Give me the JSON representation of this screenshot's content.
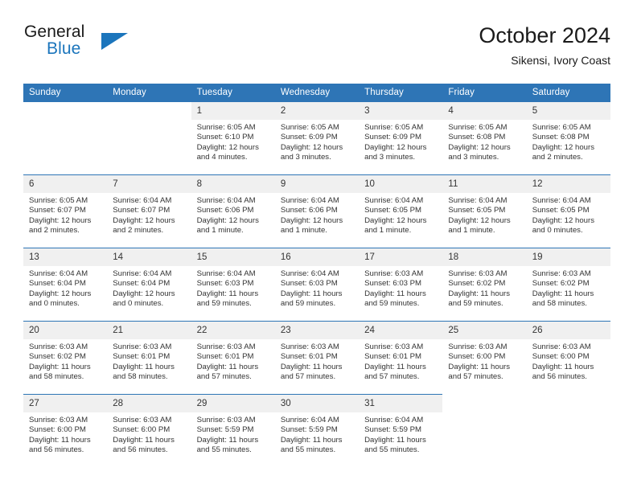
{
  "brand": {
    "name_top": "General",
    "name_bottom": "Blue",
    "triangle_color": "#1b75bc"
  },
  "header": {
    "title": "October 2024",
    "subtitle": "Sikensi, Ivory Coast"
  },
  "colors": {
    "header_blue": "#2e75b6",
    "daynum_band": "#f0f0f0",
    "text": "#333333"
  },
  "calendar": {
    "weekday_headers": [
      "Sunday",
      "Monday",
      "Tuesday",
      "Wednesday",
      "Thursday",
      "Friday",
      "Saturday"
    ],
    "weeks": [
      [
        {
          "day": "",
          "empty": true
        },
        {
          "day": "",
          "empty": true
        },
        {
          "day": "1",
          "sunrise": "Sunrise: 6:05 AM",
          "sunset": "Sunset: 6:10 PM",
          "daylight_1": "Daylight: 12 hours",
          "daylight_2": "and 4 minutes."
        },
        {
          "day": "2",
          "sunrise": "Sunrise: 6:05 AM",
          "sunset": "Sunset: 6:09 PM",
          "daylight_1": "Daylight: 12 hours",
          "daylight_2": "and 3 minutes."
        },
        {
          "day": "3",
          "sunrise": "Sunrise: 6:05 AM",
          "sunset": "Sunset: 6:09 PM",
          "daylight_1": "Daylight: 12 hours",
          "daylight_2": "and 3 minutes."
        },
        {
          "day": "4",
          "sunrise": "Sunrise: 6:05 AM",
          "sunset": "Sunset: 6:08 PM",
          "daylight_1": "Daylight: 12 hours",
          "daylight_2": "and 3 minutes."
        },
        {
          "day": "5",
          "sunrise": "Sunrise: 6:05 AM",
          "sunset": "Sunset: 6:08 PM",
          "daylight_1": "Daylight: 12 hours",
          "daylight_2": "and 2 minutes."
        }
      ],
      [
        {
          "day": "6",
          "sunrise": "Sunrise: 6:05 AM",
          "sunset": "Sunset: 6:07 PM",
          "daylight_1": "Daylight: 12 hours",
          "daylight_2": "and 2 minutes."
        },
        {
          "day": "7",
          "sunrise": "Sunrise: 6:04 AM",
          "sunset": "Sunset: 6:07 PM",
          "daylight_1": "Daylight: 12 hours",
          "daylight_2": "and 2 minutes."
        },
        {
          "day": "8",
          "sunrise": "Sunrise: 6:04 AM",
          "sunset": "Sunset: 6:06 PM",
          "daylight_1": "Daylight: 12 hours",
          "daylight_2": "and 1 minute."
        },
        {
          "day": "9",
          "sunrise": "Sunrise: 6:04 AM",
          "sunset": "Sunset: 6:06 PM",
          "daylight_1": "Daylight: 12 hours",
          "daylight_2": "and 1 minute."
        },
        {
          "day": "10",
          "sunrise": "Sunrise: 6:04 AM",
          "sunset": "Sunset: 6:05 PM",
          "daylight_1": "Daylight: 12 hours",
          "daylight_2": "and 1 minute."
        },
        {
          "day": "11",
          "sunrise": "Sunrise: 6:04 AM",
          "sunset": "Sunset: 6:05 PM",
          "daylight_1": "Daylight: 12 hours",
          "daylight_2": "and 1 minute."
        },
        {
          "day": "12",
          "sunrise": "Sunrise: 6:04 AM",
          "sunset": "Sunset: 6:05 PM",
          "daylight_1": "Daylight: 12 hours",
          "daylight_2": "and 0 minutes."
        }
      ],
      [
        {
          "day": "13",
          "sunrise": "Sunrise: 6:04 AM",
          "sunset": "Sunset: 6:04 PM",
          "daylight_1": "Daylight: 12 hours",
          "daylight_2": "and 0 minutes."
        },
        {
          "day": "14",
          "sunrise": "Sunrise: 6:04 AM",
          "sunset": "Sunset: 6:04 PM",
          "daylight_1": "Daylight: 12 hours",
          "daylight_2": "and 0 minutes."
        },
        {
          "day": "15",
          "sunrise": "Sunrise: 6:04 AM",
          "sunset": "Sunset: 6:03 PM",
          "daylight_1": "Daylight: 11 hours",
          "daylight_2": "and 59 minutes."
        },
        {
          "day": "16",
          "sunrise": "Sunrise: 6:04 AM",
          "sunset": "Sunset: 6:03 PM",
          "daylight_1": "Daylight: 11 hours",
          "daylight_2": "and 59 minutes."
        },
        {
          "day": "17",
          "sunrise": "Sunrise: 6:03 AM",
          "sunset": "Sunset: 6:03 PM",
          "daylight_1": "Daylight: 11 hours",
          "daylight_2": "and 59 minutes."
        },
        {
          "day": "18",
          "sunrise": "Sunrise: 6:03 AM",
          "sunset": "Sunset: 6:02 PM",
          "daylight_1": "Daylight: 11 hours",
          "daylight_2": "and 59 minutes."
        },
        {
          "day": "19",
          "sunrise": "Sunrise: 6:03 AM",
          "sunset": "Sunset: 6:02 PM",
          "daylight_1": "Daylight: 11 hours",
          "daylight_2": "and 58 minutes."
        }
      ],
      [
        {
          "day": "20",
          "sunrise": "Sunrise: 6:03 AM",
          "sunset": "Sunset: 6:02 PM",
          "daylight_1": "Daylight: 11 hours",
          "daylight_2": "and 58 minutes."
        },
        {
          "day": "21",
          "sunrise": "Sunrise: 6:03 AM",
          "sunset": "Sunset: 6:01 PM",
          "daylight_1": "Daylight: 11 hours",
          "daylight_2": "and 58 minutes."
        },
        {
          "day": "22",
          "sunrise": "Sunrise: 6:03 AM",
          "sunset": "Sunset: 6:01 PM",
          "daylight_1": "Daylight: 11 hours",
          "daylight_2": "and 57 minutes."
        },
        {
          "day": "23",
          "sunrise": "Sunrise: 6:03 AM",
          "sunset": "Sunset: 6:01 PM",
          "daylight_1": "Daylight: 11 hours",
          "daylight_2": "and 57 minutes."
        },
        {
          "day": "24",
          "sunrise": "Sunrise: 6:03 AM",
          "sunset": "Sunset: 6:01 PM",
          "daylight_1": "Daylight: 11 hours",
          "daylight_2": "and 57 minutes."
        },
        {
          "day": "25",
          "sunrise": "Sunrise: 6:03 AM",
          "sunset": "Sunset: 6:00 PM",
          "daylight_1": "Daylight: 11 hours",
          "daylight_2": "and 57 minutes."
        },
        {
          "day": "26",
          "sunrise": "Sunrise: 6:03 AM",
          "sunset": "Sunset: 6:00 PM",
          "daylight_1": "Daylight: 11 hours",
          "daylight_2": "and 56 minutes."
        }
      ],
      [
        {
          "day": "27",
          "sunrise": "Sunrise: 6:03 AM",
          "sunset": "Sunset: 6:00 PM",
          "daylight_1": "Daylight: 11 hours",
          "daylight_2": "and 56 minutes."
        },
        {
          "day": "28",
          "sunrise": "Sunrise: 6:03 AM",
          "sunset": "Sunset: 6:00 PM",
          "daylight_1": "Daylight: 11 hours",
          "daylight_2": "and 56 minutes."
        },
        {
          "day": "29",
          "sunrise": "Sunrise: 6:03 AM",
          "sunset": "Sunset: 5:59 PM",
          "daylight_1": "Daylight: 11 hours",
          "daylight_2": "and 55 minutes."
        },
        {
          "day": "30",
          "sunrise": "Sunrise: 6:04 AM",
          "sunset": "Sunset: 5:59 PM",
          "daylight_1": "Daylight: 11 hours",
          "daylight_2": "and 55 minutes."
        },
        {
          "day": "31",
          "sunrise": "Sunrise: 6:04 AM",
          "sunset": "Sunset: 5:59 PM",
          "daylight_1": "Daylight: 11 hours",
          "daylight_2": "and 55 minutes."
        },
        {
          "day": "",
          "empty": true
        },
        {
          "day": "",
          "empty": true
        }
      ]
    ]
  }
}
